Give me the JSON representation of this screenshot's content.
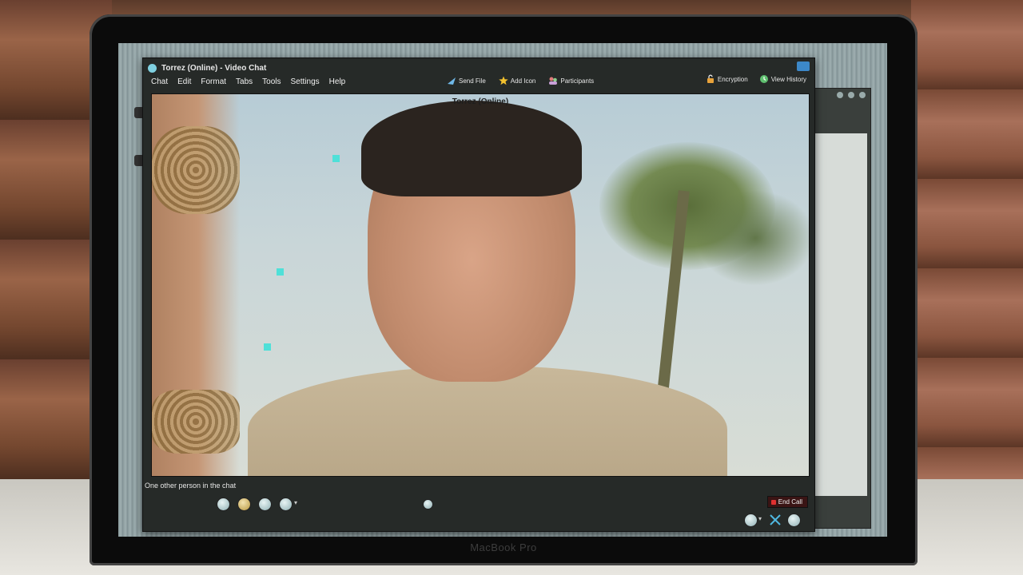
{
  "window": {
    "title": "Torrez (Online) - Video Chat"
  },
  "menu": [
    "Chat",
    "Edit",
    "Format",
    "Tabs",
    "Tools",
    "Settings",
    "Help"
  ],
  "toolbar": {
    "send_file": "Send File",
    "add_icon": "Add Icon",
    "participants": "Participants",
    "encryption": "Encryption",
    "view_history": "View History"
  },
  "video": {
    "caller_label": "Torrez",
    "caller_status": "(Online)"
  },
  "status": {
    "text": "One other person in the chat"
  },
  "controls": {
    "end_call": "End Call"
  },
  "device": {
    "brand": "MacBook Pro"
  },
  "colors": {
    "end_call_indicator": "#e03030",
    "online_icon": "#7fd0e0",
    "marker": "#4fe0d8"
  }
}
